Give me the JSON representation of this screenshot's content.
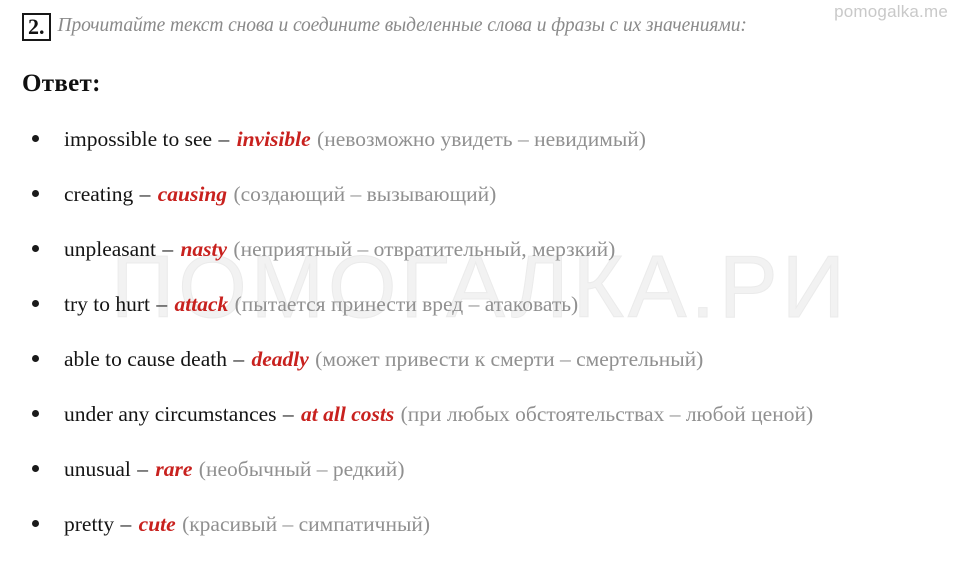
{
  "watermarks": {
    "corner": "pomogalka.me",
    "background": "ПОМОГАЛКА.РИ"
  },
  "task": {
    "number": "2.",
    "prompt": "Прочитайте текст снова и соедините выделенные слова и фразы с их значениями:"
  },
  "answer": {
    "heading": "Ответ:",
    "items": [
      {
        "english": "impossible to see",
        "dash": "–",
        "match": "invisible",
        "russian": "(невозможно увидеть – невидимый)"
      },
      {
        "english": "creating",
        "dash": "–",
        "match": "causing",
        "russian": "(создающий – вызывающий)"
      },
      {
        "english": "unpleasant",
        "dash": "–",
        "match": "nasty",
        "russian": "(неприятный – отвратительный, мерзкий)"
      },
      {
        "english": "try to hurt",
        "dash": "–",
        "match": "attack",
        "russian": "(пытается принести вред – атаковать)"
      },
      {
        "english": "able to cause death",
        "dash": "–",
        "match": "deadly",
        "russian": "(может привести к смерти – смертельный)"
      },
      {
        "english": "under any circumstances",
        "dash": "–",
        "match": "at all costs",
        "russian": "(при любых обстоятельствах – любой ценой)"
      },
      {
        "english": "unusual",
        "dash": "–",
        "match": "rare",
        "russian": "(необычный – редкий)"
      },
      {
        "english": "pretty",
        "dash": "–",
        "match": "cute",
        "russian": "(красивый – симпатичный)"
      }
    ]
  },
  "colors": {
    "answer_red": "#c8211e",
    "russian_gray": "#909090",
    "prompt_gray": "#8a8a8a",
    "watermark_gray": "#f2f2f2",
    "corner_watermark_gray": "#c9c9c9"
  }
}
